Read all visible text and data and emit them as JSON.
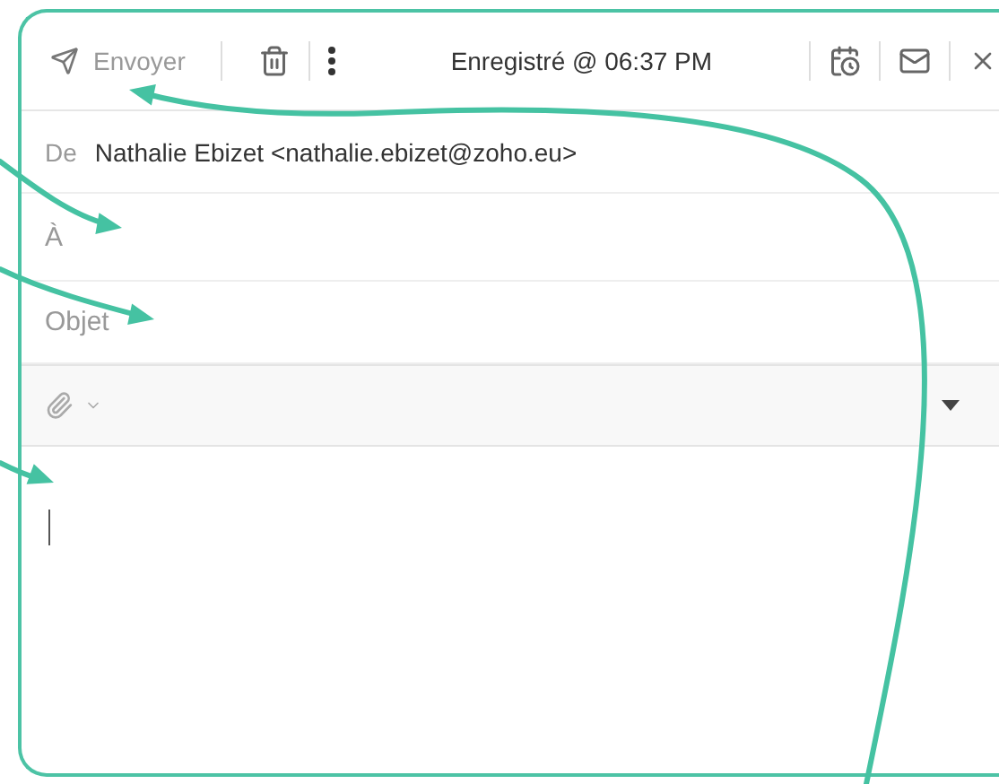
{
  "toolbar": {
    "send_label": "Envoyer",
    "saved_status": "Enregistré @ 06:37 PM"
  },
  "from": {
    "label": "De",
    "value": "Nathalie Ebizet <nathalie.ebizet@zoho.eu>"
  },
  "to": {
    "placeholder": "À"
  },
  "subject": {
    "placeholder": "Objet"
  }
}
